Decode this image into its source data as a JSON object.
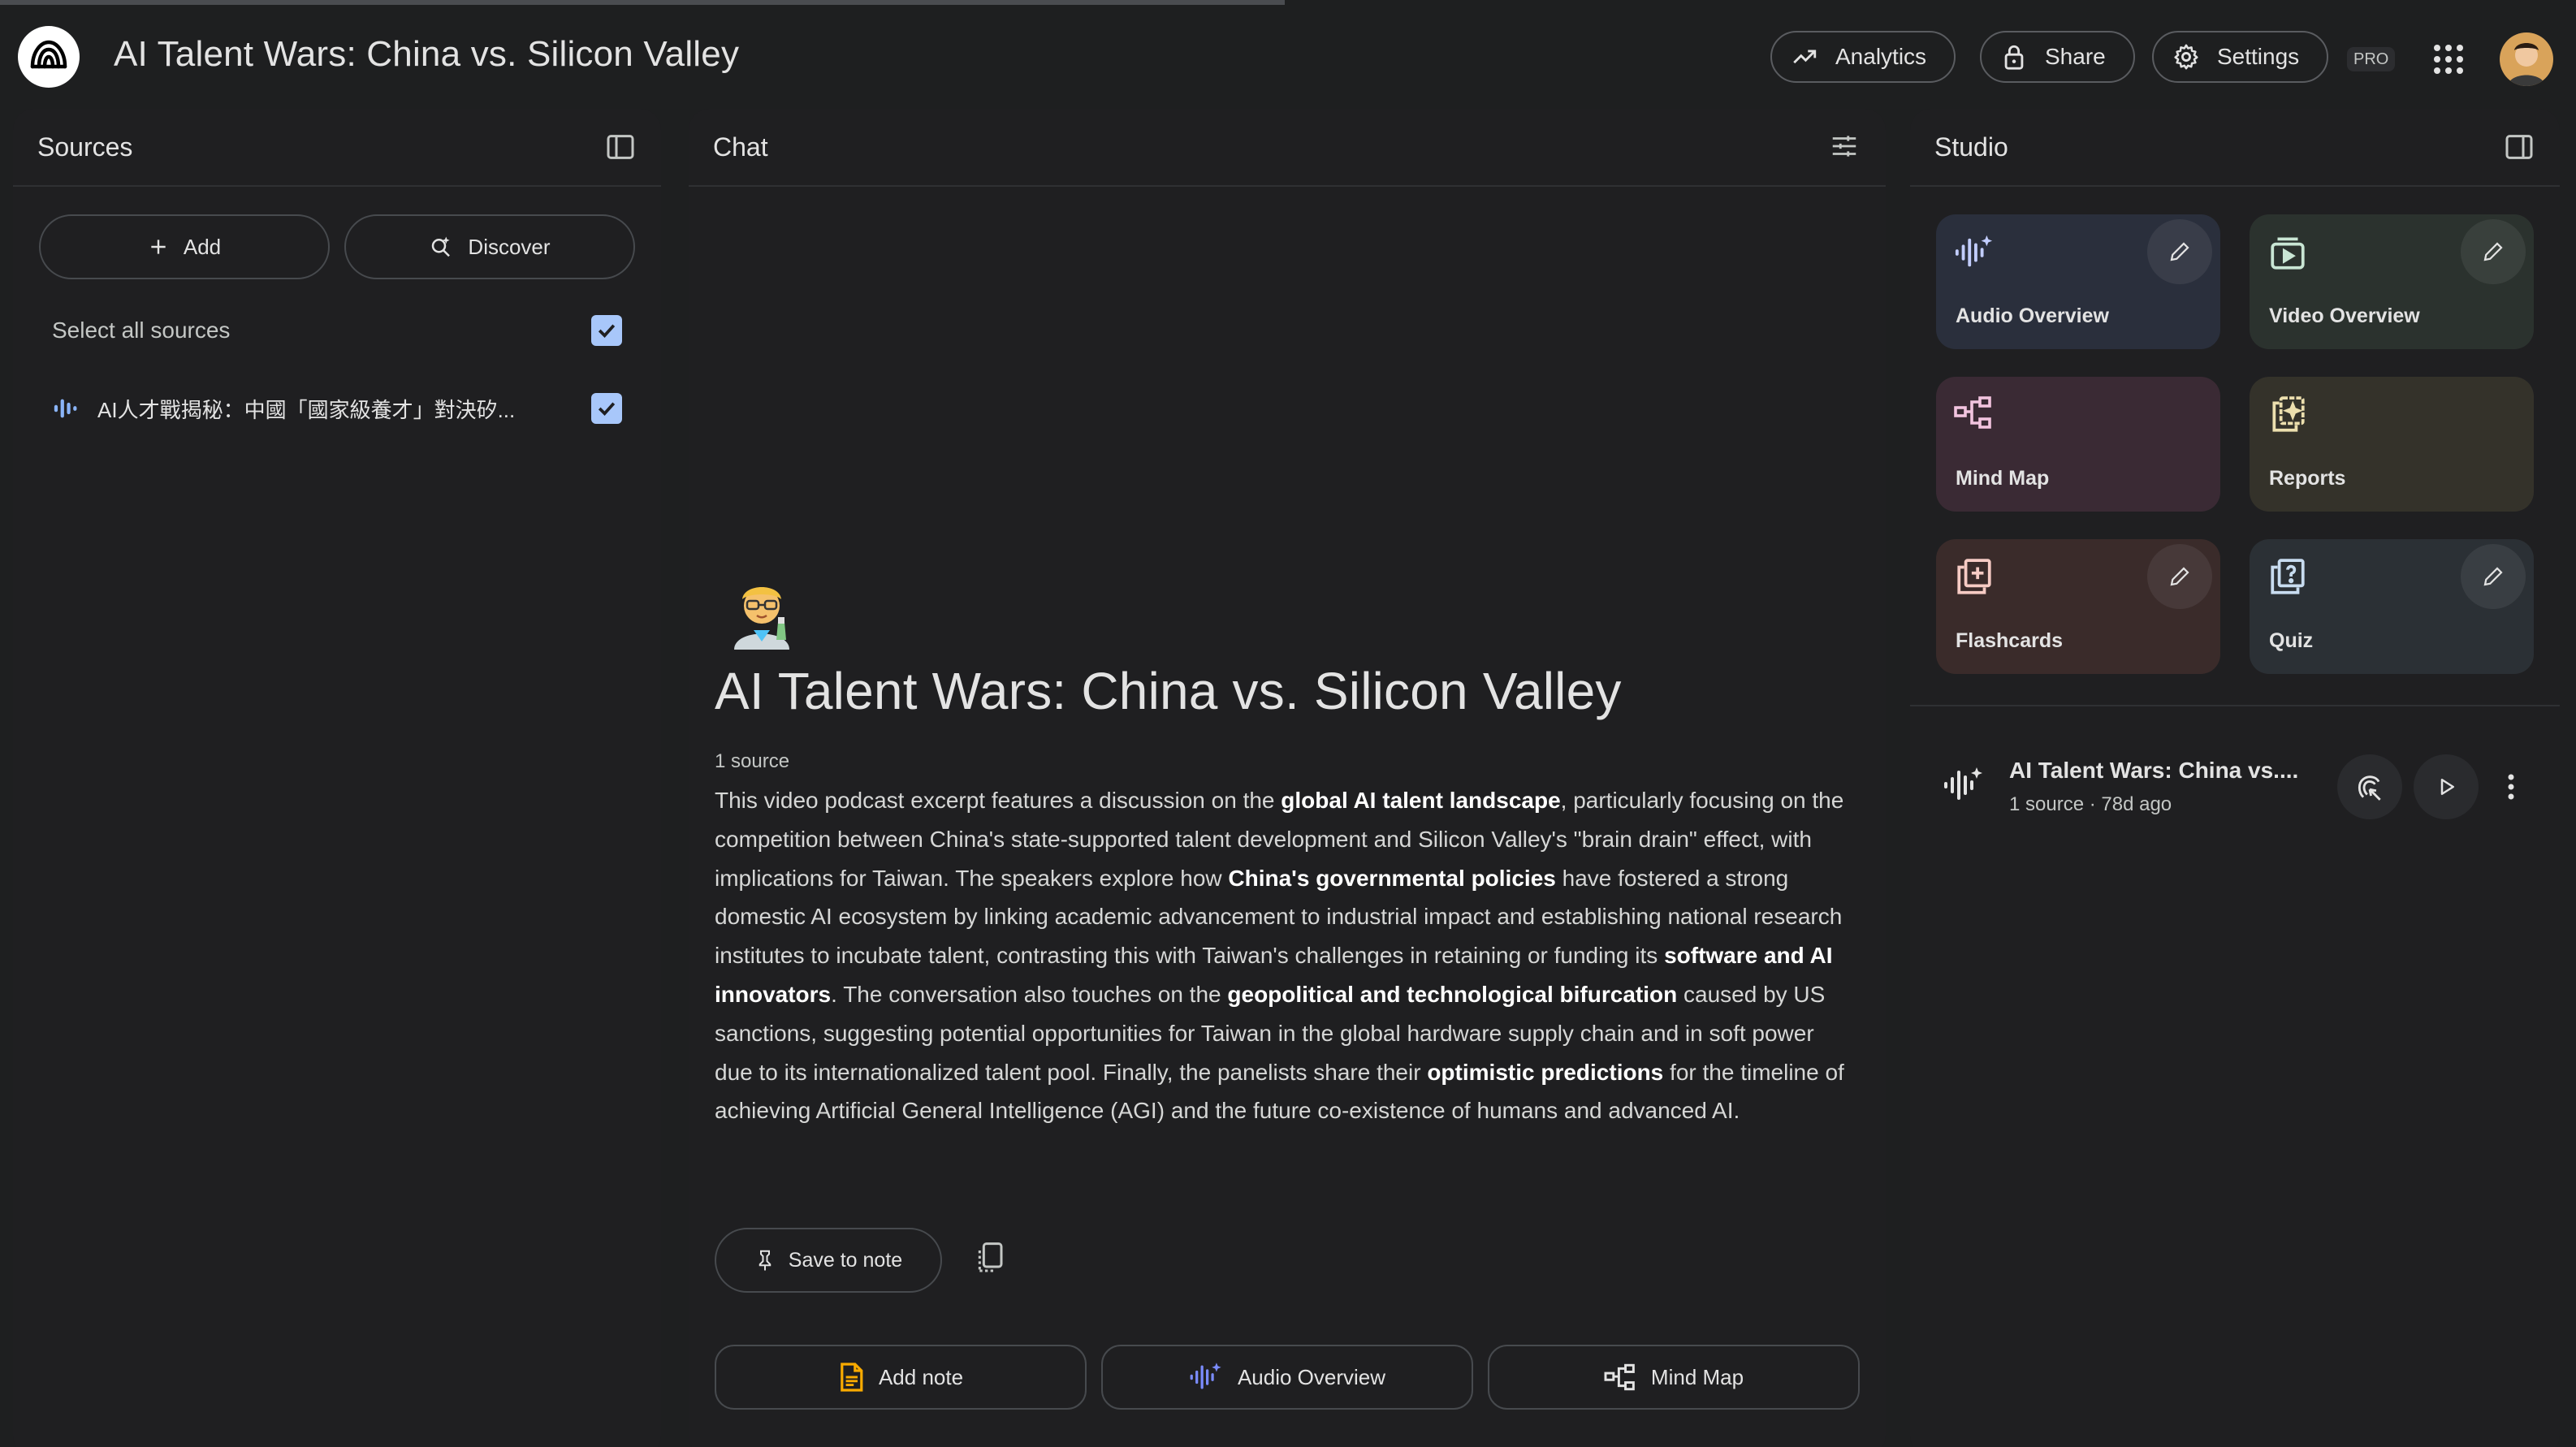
{
  "app": {
    "title": "AI Talent Wars: China vs. Silicon Valley",
    "accent_color": "#a8c7fa",
    "progress_fraction": 0.5
  },
  "header": {
    "analytics_label": "Analytics",
    "share_label": "Share",
    "settings_label": "Settings",
    "pro_badge": "PRO",
    "icons": [
      "notebooklm-logo-icon",
      "trending-up-icon",
      "lock-icon",
      "gear-icon",
      "apps-grid-icon",
      "user-avatar"
    ]
  },
  "sources": {
    "title": "Sources",
    "add_label": "Add",
    "discover_label": "Discover",
    "select_all_label": "Select all sources",
    "select_all_checked": true,
    "items": [
      {
        "label": "AI人才戰揭秘：中國「國家級養才」對決矽...",
        "checked": true,
        "icon": "audio-source-icon"
      }
    ]
  },
  "chat": {
    "title": "Chat",
    "emoji": "🧑‍🔬",
    "notebook_title": "AI Talent Wars: China vs. Silicon Valley",
    "source_count": "1 source",
    "summary": [
      {
        "t": "This video podcast excerpt features a discussion on the "
      },
      {
        "t": "global AI talent landscape",
        "b": true
      },
      {
        "t": ", particularly focusing on the competition between China's state-supported talent development and Silicon Valley's \"brain drain\" effect, with implications for Taiwan. The speakers explore how "
      },
      {
        "t": "China's governmental policies",
        "b": true
      },
      {
        "t": " have fostered a strong domestic AI ecosystem by linking academic advancement to industrial impact and establishing national research institutes to incubate talent, contrasting this with Taiwan's challenges in retaining or funding its "
      },
      {
        "t": "software and AI innovators",
        "b": true
      },
      {
        "t": ". The conversation also touches on the "
      },
      {
        "t": "geopolitical and technological bifurcation",
        "b": true
      },
      {
        "t": " caused by US sanctions, suggesting potential opportunities for Taiwan in the global hardware supply chain and in soft power due to its internationalized talent pool. Finally, the panelists share their "
      },
      {
        "t": "optimistic predictions",
        "b": true
      },
      {
        "t": " for the timeline of achieving Artificial General Intelligence (AGI) and the future co-existence of humans and advanced AI."
      }
    ],
    "save_to_note_label": "Save to note",
    "add_note_label": "Add note",
    "audio_overview_label": "Audio Overview",
    "mind_map_label": "Mind Map"
  },
  "studio": {
    "title": "Studio",
    "tiles": {
      "audio_overview": "Audio Overview",
      "video_overview": "Video Overview",
      "mind_map": "Mind Map",
      "reports": "Reports",
      "flashcards": "Flashcards",
      "quiz": "Quiz"
    },
    "artifact": {
      "title": "AI Talent Wars: China vs....",
      "subtitle": "1 source · 78d ago"
    }
  }
}
